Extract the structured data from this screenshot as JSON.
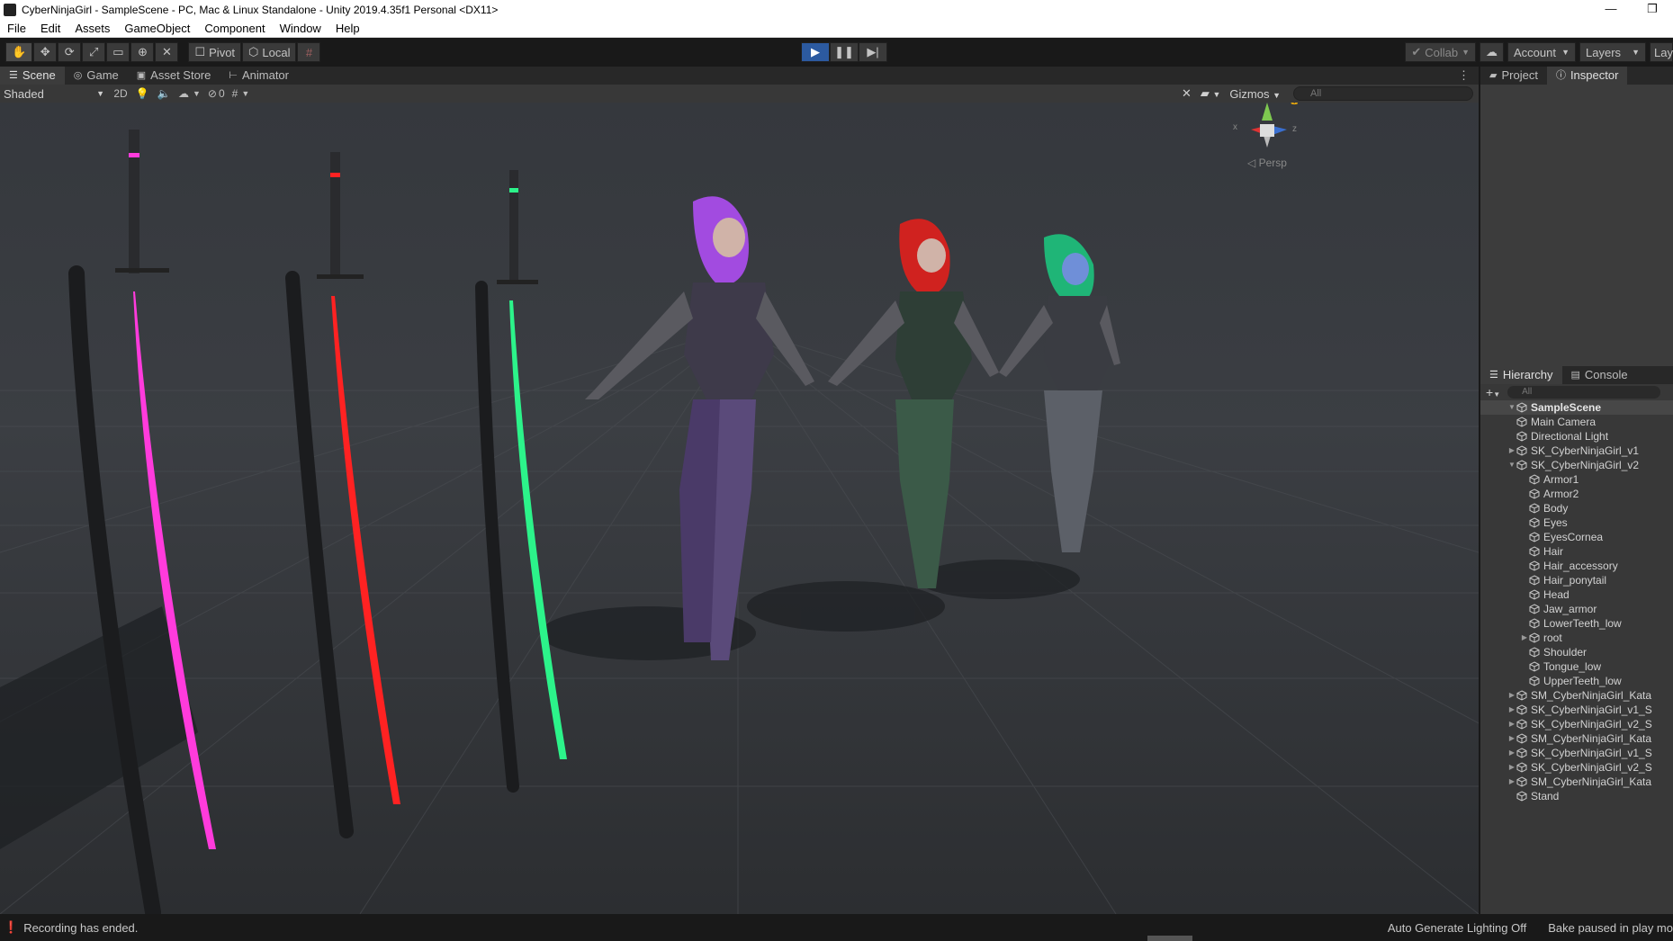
{
  "window": {
    "title": "CyberNinjaGirl - SampleScene - PC, Mac & Linux Standalone - Unity 2019.4.35f1 Personal <DX11>",
    "minimize": "—",
    "maximize": "❐"
  },
  "menu": [
    "File",
    "Edit",
    "Assets",
    "GameObject",
    "Component",
    "Window",
    "Help"
  ],
  "toolbar": {
    "tools": [
      "hand",
      "move",
      "rotate",
      "scale",
      "rect",
      "transform",
      "custom"
    ],
    "pivot_label": "Pivot",
    "local_label": "Local",
    "collab_label": "Collab",
    "account_label": "Account",
    "layers_label": "Layers",
    "layout_label": "Lay"
  },
  "scene_tabs": [
    {
      "label": "Scene",
      "active": true
    },
    {
      "label": "Game",
      "active": false
    },
    {
      "label": "Asset Store",
      "active": false
    },
    {
      "label": "Animator",
      "active": false
    }
  ],
  "scene_toolbar": {
    "shading_mode": "Shaded",
    "mode_2d": "2D",
    "hidden_count": "0",
    "gizmos_label": "Gizmos",
    "search_placeholder": "All"
  },
  "viewport": {
    "persp_label": "Persp",
    "axis_x": "x",
    "axis_z": "z"
  },
  "right_tabs": [
    {
      "label": "Project"
    },
    {
      "label": "Inspector"
    }
  ],
  "hierarchy_tabs": [
    {
      "label": "Hierarchy"
    },
    {
      "label": "Console"
    }
  ],
  "hierarchy": {
    "search_placeholder": "All",
    "items": [
      {
        "label": "SampleScene",
        "indent": 0,
        "arrow": "down",
        "scene": true
      },
      {
        "label": "Main Camera",
        "indent": 1,
        "arrow": ""
      },
      {
        "label": "Directional Light",
        "indent": 1,
        "arrow": ""
      },
      {
        "label": "SK_CyberNinjaGirl_v1",
        "indent": 1,
        "arrow": "right"
      },
      {
        "label": "SK_CyberNinjaGirl_v2",
        "indent": 1,
        "arrow": "down"
      },
      {
        "label": "Armor1",
        "indent": 2,
        "arrow": ""
      },
      {
        "label": "Armor2",
        "indent": 2,
        "arrow": ""
      },
      {
        "label": "Body",
        "indent": 2,
        "arrow": ""
      },
      {
        "label": "Eyes",
        "indent": 2,
        "arrow": ""
      },
      {
        "label": "EyesCornea",
        "indent": 2,
        "arrow": ""
      },
      {
        "label": "Hair",
        "indent": 2,
        "arrow": ""
      },
      {
        "label": "Hair_accessory",
        "indent": 2,
        "arrow": ""
      },
      {
        "label": "Hair_ponytail",
        "indent": 2,
        "arrow": ""
      },
      {
        "label": "Head",
        "indent": 2,
        "arrow": ""
      },
      {
        "label": "Jaw_armor",
        "indent": 2,
        "arrow": ""
      },
      {
        "label": "LowerTeeth_low",
        "indent": 2,
        "arrow": ""
      },
      {
        "label": "root",
        "indent": 2,
        "arrow": "right"
      },
      {
        "label": "Shoulder",
        "indent": 2,
        "arrow": ""
      },
      {
        "label": "Tongue_low",
        "indent": 2,
        "arrow": ""
      },
      {
        "label": "UpperTeeth_low",
        "indent": 2,
        "arrow": ""
      },
      {
        "label": "SM_CyberNinjaGirl_Kata",
        "indent": 1,
        "arrow": "right"
      },
      {
        "label": "SK_CyberNinjaGirl_v1_S",
        "indent": 1,
        "arrow": "right"
      },
      {
        "label": "SK_CyberNinjaGirl_v2_S",
        "indent": 1,
        "arrow": "right"
      },
      {
        "label": "SM_CyberNinjaGirl_Kata",
        "indent": 1,
        "arrow": "right"
      },
      {
        "label": "SK_CyberNinjaGirl_v1_S",
        "indent": 1,
        "arrow": "right"
      },
      {
        "label": "SK_CyberNinjaGirl_v2_S",
        "indent": 1,
        "arrow": "right"
      },
      {
        "label": "SM_CyberNinjaGirl_Kata",
        "indent": 1,
        "arrow": "right"
      },
      {
        "label": "Stand",
        "indent": 1,
        "arrow": ""
      }
    ]
  },
  "status": {
    "message": "Recording has ended.",
    "lighting": "Auto Generate Lighting Off",
    "bake": "Bake paused in play mo"
  },
  "colors": {
    "play_active": "#2c5aa0",
    "sword_pink": "#ff3bdc",
    "sword_red": "#ff2222",
    "sword_green": "#2cf38a",
    "hair_purple": "#a24be0",
    "hair_red": "#d0221f",
    "hair_green": "#1fb577"
  }
}
